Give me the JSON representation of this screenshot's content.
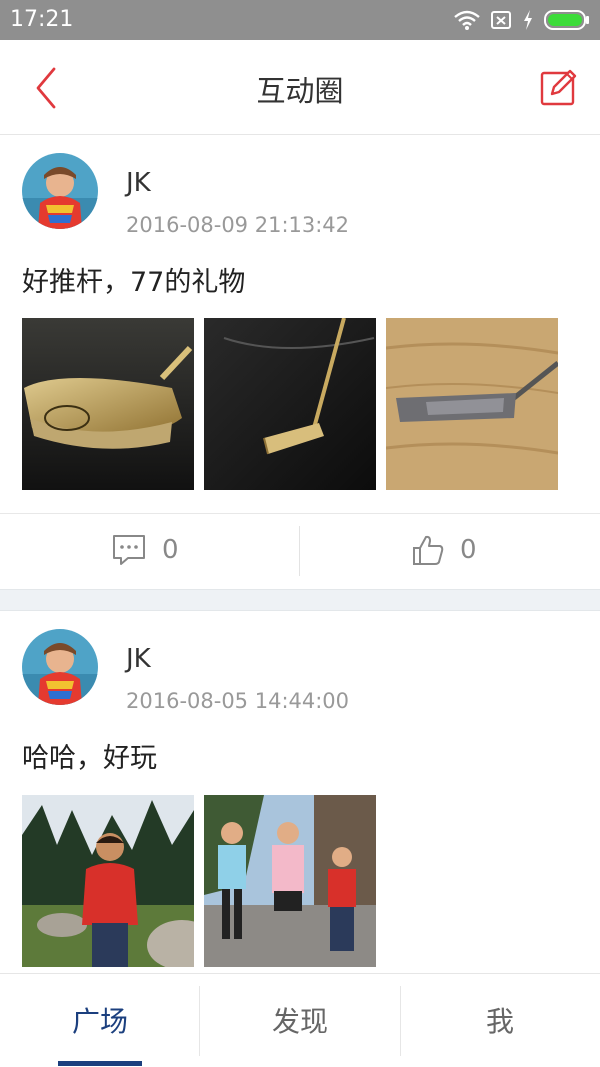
{
  "status_bar": {
    "time": "17:21",
    "icons": [
      "wifi-icon",
      "sim-off-icon",
      "charging-icon",
      "battery-icon"
    ]
  },
  "header": {
    "title": "互动圈",
    "back_icon": "chevron-left-icon",
    "edit_icon": "edit-icon"
  },
  "posts": [
    {
      "author": "JK",
      "time": "2016-08-09 21:13:42",
      "text": "好推杆，77的礼物",
      "photos": [
        "putter-closeup-photo",
        "putter-floor-photo",
        "putter-wood-photo"
      ],
      "comments": "0",
      "likes": "0"
    },
    {
      "author": "JK",
      "time": "2016-08-05 14:44:00",
      "text": "哈哈，好玩",
      "photos": [
        "boy-forest-photo",
        "kids-jumping-photo"
      ]
    }
  ],
  "tabs": [
    {
      "label": "广场",
      "active": true
    },
    {
      "label": "发现",
      "active": false
    },
    {
      "label": "我",
      "active": false
    }
  ],
  "colors": {
    "accent_red": "#e0393e",
    "tab_active": "#1b3f7e",
    "status_bar": "#8f8f8f",
    "battery": "#3ddc3a"
  }
}
